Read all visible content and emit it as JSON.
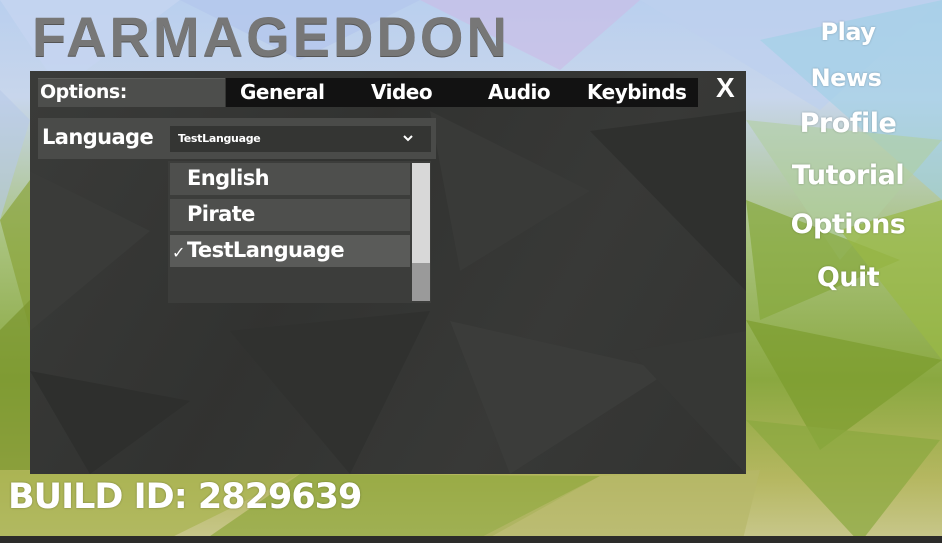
{
  "game": {
    "title": "FARMAGEDDON"
  },
  "menu": {
    "items": [
      {
        "label": "Play"
      },
      {
        "label": "News"
      },
      {
        "label": "Profile"
      },
      {
        "label": "Tutorial"
      },
      {
        "label": "Options"
      },
      {
        "label": "Quit"
      }
    ]
  },
  "options_panel": {
    "label": "Options:",
    "tabs": [
      {
        "label": "General"
      },
      {
        "label": "Video"
      },
      {
        "label": "Audio"
      },
      {
        "label": "Keybinds"
      }
    ],
    "close_label": "X",
    "language": {
      "label": "Language",
      "selected": "TestLanguage",
      "options": [
        {
          "label": "English",
          "checked": false
        },
        {
          "label": "Pirate",
          "checked": false
        },
        {
          "label": "TestLanguage",
          "checked": true
        }
      ],
      "check_mark": "✓",
      "chevron_icon": "chevron-down-icon"
    }
  },
  "footer": {
    "build_id": "BUILD ID: 2829639"
  },
  "colors": {
    "panel_bg": "#343533",
    "tabbar_bg": "#121212",
    "title_gray": "#777777",
    "text": "#ffffff"
  }
}
